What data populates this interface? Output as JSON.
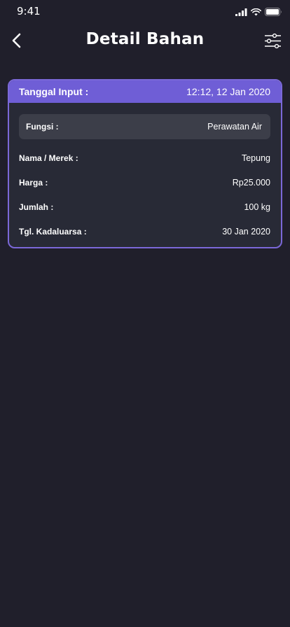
{
  "status_bar": {
    "time": "9:41",
    "icons": [
      "cellular-signal-icon",
      "wifi-icon",
      "battery-icon"
    ]
  },
  "header": {
    "title": "Detail Bahan",
    "back_icon": "chevron-left-icon",
    "filter_icon": "sliders-icon"
  },
  "card": {
    "header_label": "Tanggal Input :",
    "header_value": "12:12, 12 Jan 2020",
    "fungsi": {
      "label": "Fungsi :",
      "value": "Perawatan Air"
    },
    "rows": [
      {
        "label": "Nama / Merek :",
        "value": "Tepung"
      },
      {
        "label": "Harga :",
        "value": "Rp25.000"
      },
      {
        "label": "Jumlah :",
        "value": "100 kg"
      },
      {
        "label": "Tgl. Kadaluarsa :",
        "value": "30 Jan 2020"
      }
    ]
  },
  "colors": {
    "background": "#201f2b",
    "accent": "#6f5ed6",
    "card_bg": "#282a36",
    "field_bg": "#3c3e49"
  }
}
